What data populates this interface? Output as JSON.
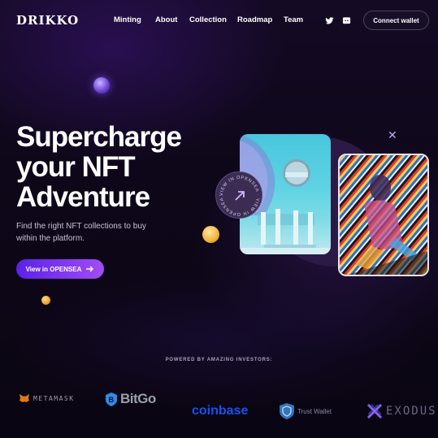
{
  "header": {
    "logo": "DRIKKO",
    "nav": [
      "Minting",
      "About",
      "Collection",
      "Roadmap",
      "Team"
    ],
    "social_icons": [
      "twitter-icon",
      "discord-icon"
    ],
    "connect_label": "Connect wallet"
  },
  "hero": {
    "title_line1": "Supercharge",
    "title_line2": "your NFT",
    "title_line3": "Adventure",
    "subtitle_line1": "Find the right NFT collections to buy",
    "subtitle_line2": "within the platform.",
    "cta_label": "View in OPENSEA",
    "badge_ring_text": "VIEW IN OPENSEA · VIEW IN OPENSEA ·"
  },
  "investors": {
    "heading": "POWERED BY AMAZING INVESTORS:",
    "logos": [
      {
        "name": "METAMASK"
      },
      {
        "name": "BitGo"
      },
      {
        "name": "coinbase"
      },
      {
        "name": "Trust Wallet"
      },
      {
        "name": "EXODUS"
      }
    ]
  },
  "colors": {
    "background": "#0c0616",
    "cta_gradient_start": "#5b21e6",
    "cta_gradient_end": "#a24cf5",
    "coinbase_blue": "#1652f0",
    "trust_blue": "#3375bb",
    "exodus_purple": "#8b5cf6"
  }
}
